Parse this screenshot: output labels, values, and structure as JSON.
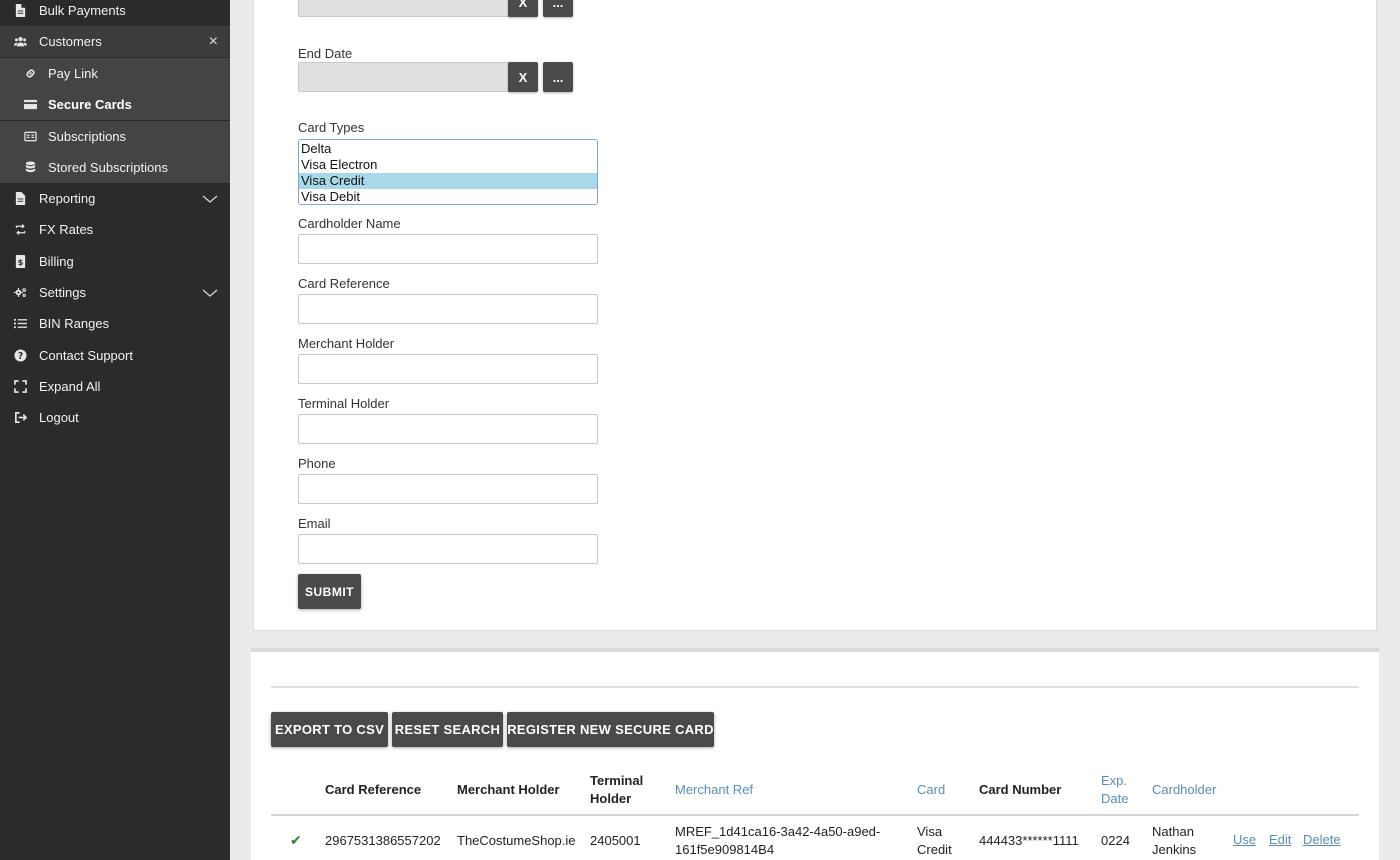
{
  "sidebar": {
    "items": [
      {
        "label": "Bulk Payments"
      },
      {
        "label": "Customers",
        "close_glyph": "×"
      },
      {
        "label": "Pay Link"
      },
      {
        "label": "Secure Cards"
      },
      {
        "label": "Subscriptions"
      },
      {
        "label": "Stored Subscriptions"
      },
      {
        "label": "Reporting"
      },
      {
        "label": "FX Rates"
      },
      {
        "label": "Billing"
      },
      {
        "label": "Settings"
      },
      {
        "label": "BIN Ranges"
      },
      {
        "label": "Contact Support"
      },
      {
        "label": "Expand All"
      },
      {
        "label": "Logout"
      }
    ]
  },
  "form": {
    "start_date": {
      "value": "",
      "clear_label": "X",
      "picker_label": "..."
    },
    "end_date": {
      "label": "End Date",
      "value": "",
      "clear_label": "X",
      "picker_label": "..."
    },
    "card_types": {
      "label": "Card Types",
      "options": [
        "Delta",
        "Visa Electron",
        "Visa Credit",
        "Visa Debit"
      ],
      "selected": "Visa Credit"
    },
    "cardholder_name": {
      "label": "Cardholder Name",
      "value": ""
    },
    "card_reference": {
      "label": "Card Reference",
      "value": ""
    },
    "merchant_holder": {
      "label": "Merchant Holder",
      "value": ""
    },
    "terminal_holder": {
      "label": "Terminal Holder",
      "value": ""
    },
    "phone": {
      "label": "Phone",
      "value": ""
    },
    "email": {
      "label": "Email",
      "value": ""
    },
    "submit_label": "SUBMIT"
  },
  "results": {
    "buttons": {
      "export": "EXPORT TO CSV",
      "reset": "RESET SEARCH",
      "register": "REGISTER NEW SECURE CARD"
    },
    "columns": {
      "card_reference": "Card Reference",
      "merchant_holder": "Merchant Holder",
      "terminal_holder_1": "Terminal",
      "terminal_holder_2": "Holder",
      "merchant_ref": "Merchant Ref",
      "card": "Card",
      "card_number": "Card Number",
      "exp_date_1": "Exp.",
      "exp_date_2": "Date",
      "cardholder": "Cardholder"
    },
    "rows": [
      {
        "check": "✔",
        "card_reference": "2967531386557202",
        "merchant_holder": "TheCostumeShop.ie",
        "terminal_holder": "2405001",
        "merchant_ref_1": "MREF_1d41ca16-3a42-4a50-a9ed-",
        "merchant_ref_2": "161f5e909814B4",
        "card_1": "Visa",
        "card_2": "Credit",
        "card_number": "444433******1111",
        "exp_date": "0224",
        "cardholder_1": "Nathan",
        "cardholder_2": "Jenkins",
        "use": "Use",
        "edit": "Edit",
        "delete": "Delete"
      }
    ]
  },
  "colors": {
    "sidebar_bg": "#2b2b2b",
    "sidebar_sub_bg": "#444444",
    "button_bg": "#4a4a4a",
    "link": "#5b8db5",
    "selected_option": "#a8d8ea",
    "check": "#2e7d32"
  }
}
